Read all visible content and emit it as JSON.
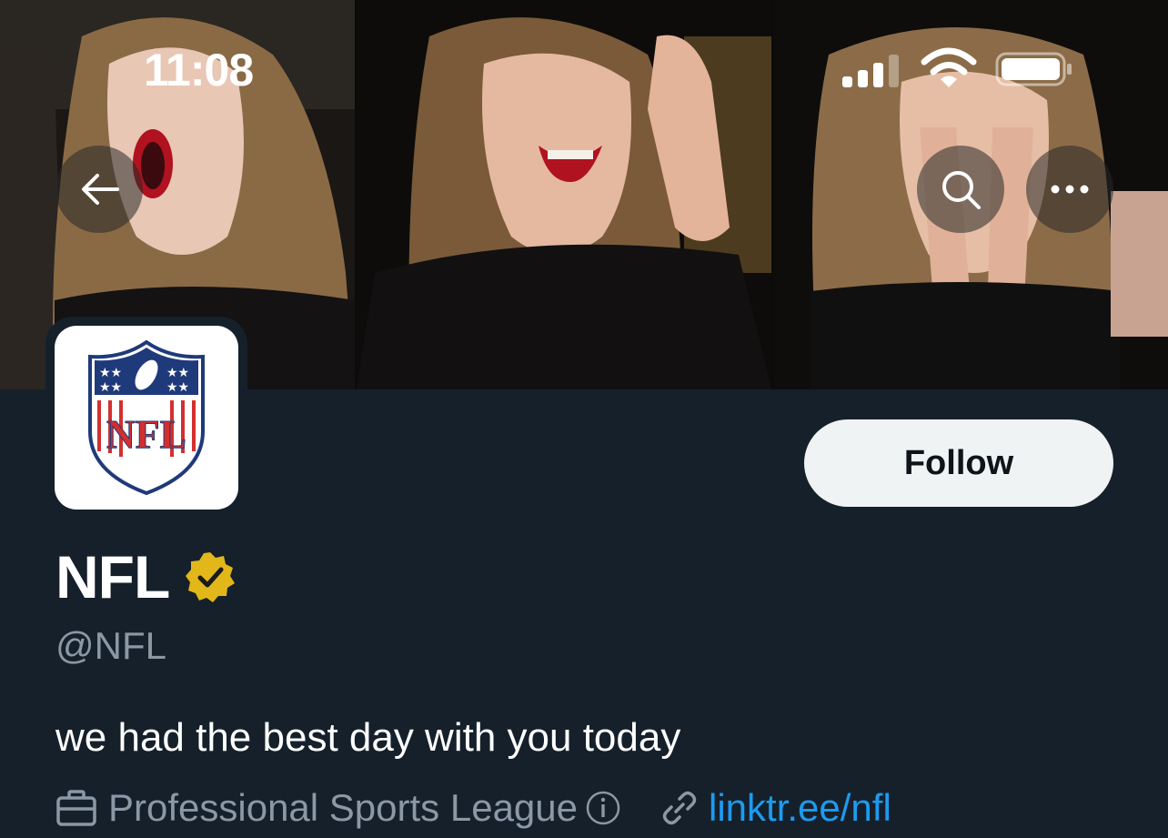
{
  "status_bar": {
    "time": "11:08"
  },
  "header": {
    "back_icon": "arrow-left-icon",
    "search_icon": "search-icon",
    "more_icon": "more-horizontal-icon"
  },
  "profile": {
    "avatar_label": "NFL",
    "name": "NFL",
    "verified_badge": "gold-verified-icon",
    "handle": "@NFL",
    "bio": "we had the best day with you today",
    "category": "Professional Sports League",
    "link": "linktr.ee/nfl",
    "follow_label": "Follow"
  },
  "colors": {
    "background": "#15202b",
    "secondary_text": "#8b98a5",
    "link": "#1d9bf0",
    "follow_button_bg": "#eff3f4",
    "verified_gold": "#e2b719"
  }
}
